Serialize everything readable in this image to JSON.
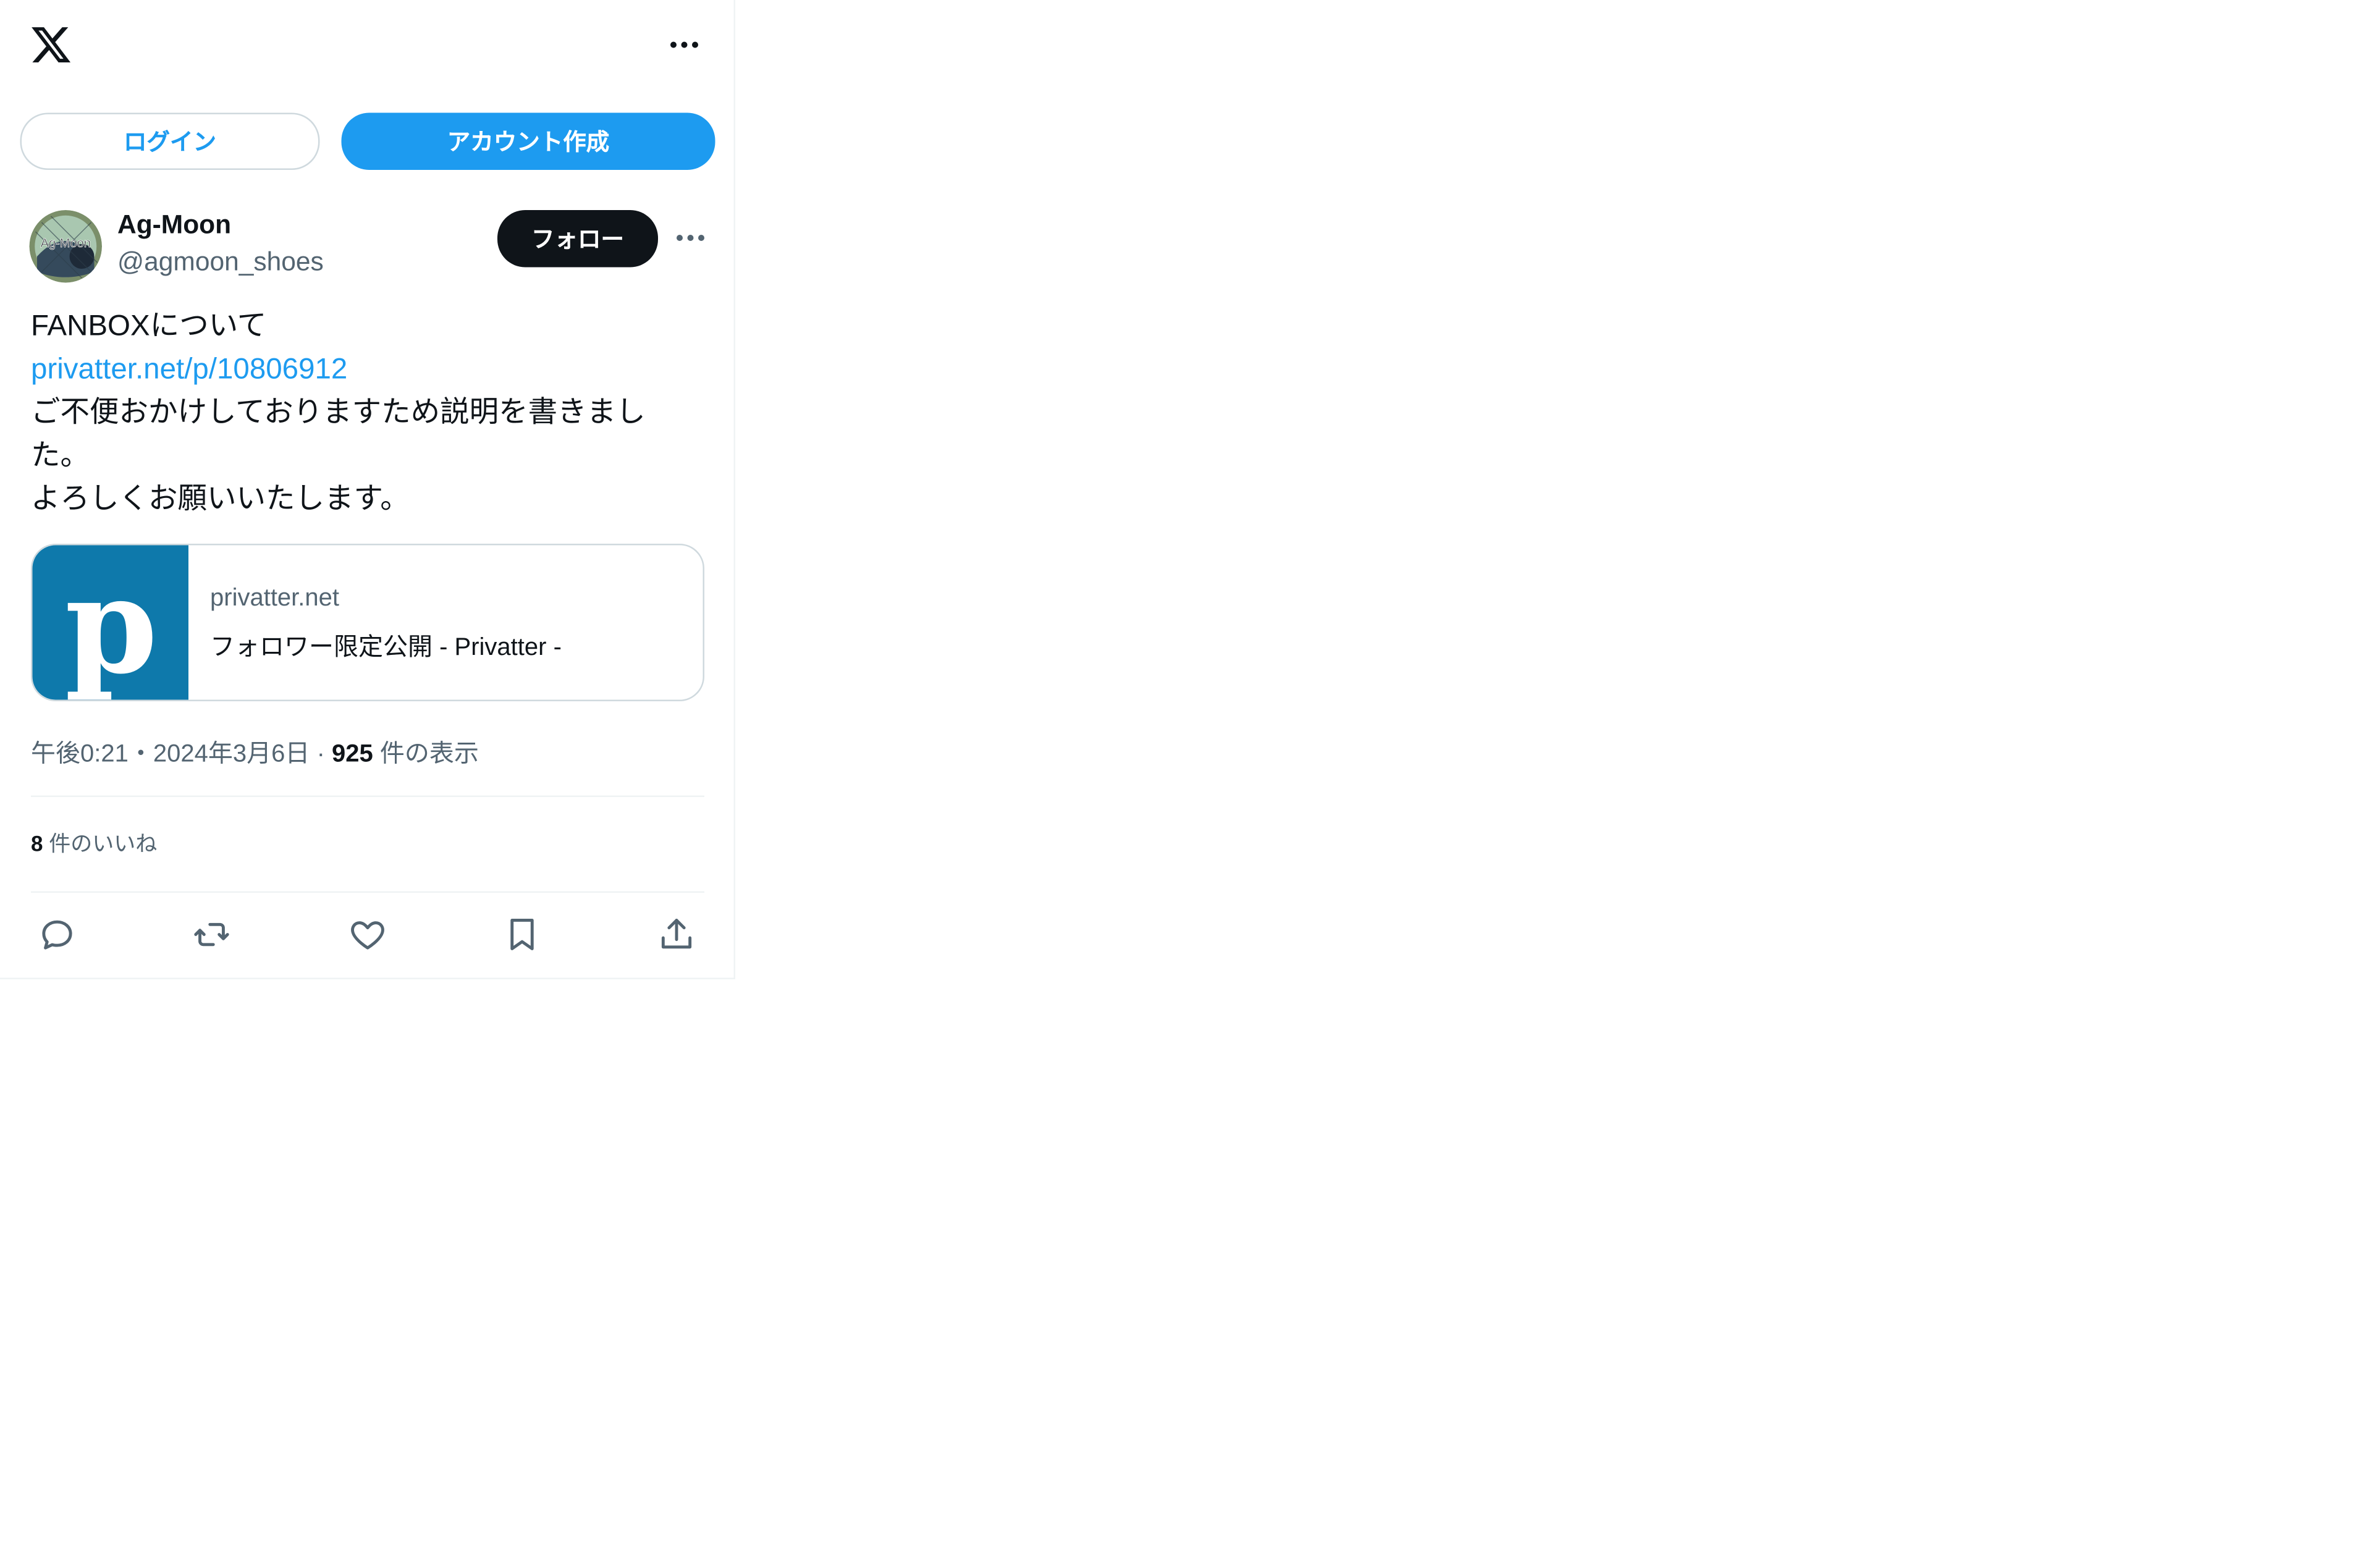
{
  "header": {
    "logo_icon": "x-logo-icon",
    "more_icon": "more-horizontal-icon"
  },
  "auth": {
    "login_label": "ログイン",
    "signup_label": "アカウント作成"
  },
  "tweet": {
    "author_name": "Ag-Moon",
    "author_handle": "@agmoon_shoes",
    "avatar_text": "Ag-Moon",
    "follow_label": "フォロー",
    "body_line1": "FANBOXについて",
    "body_link": "privatter.net/p/10806912",
    "body_line3": "ご不便おかけしておりますため説明を書きまし",
    "body_line4": "た。",
    "body_line5": "よろしくお願いいたします。",
    "card": {
      "domain": "privatter.net",
      "title": "フォロワー限定公開 - Privatter -",
      "image_icon": "privatter-logo-icon"
    },
    "time": "午後0:21",
    "date": "2024年3月6日",
    "sep1": "・",
    "sep2": "·",
    "views_count": "925",
    "views_label": "件の表示",
    "likes_count": "8",
    "likes_label": "件のいいね"
  },
  "actions": [
    {
      "icon": "reply-icon"
    },
    {
      "icon": "retweet-icon"
    },
    {
      "icon": "like-icon"
    },
    {
      "icon": "bookmark-icon"
    },
    {
      "icon": "share-icon"
    }
  ],
  "colors": {
    "accent": "#1d9bf0",
    "text": "#0f1419",
    "secondary": "#536471",
    "border": "#cfd9de",
    "card_image_bg": "#0e79ab"
  }
}
